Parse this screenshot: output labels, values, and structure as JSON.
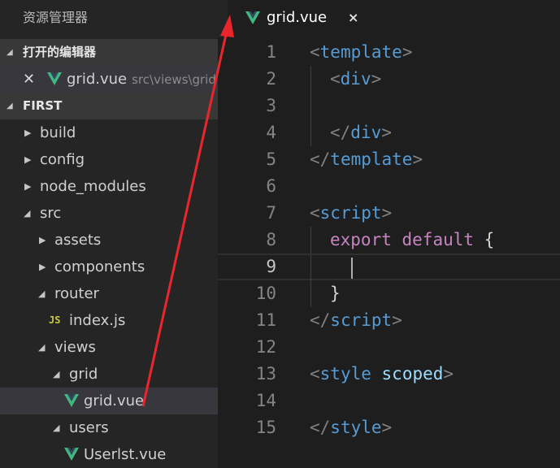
{
  "explorer": {
    "title": "资源管理器",
    "open_editors": {
      "header": "打开的编辑器",
      "items": [
        {
          "name": "grid.vue",
          "path": "src\\views\\grid"
        }
      ]
    },
    "project": {
      "header": "FIRST",
      "tree": [
        {
          "label": "build"
        },
        {
          "label": "config"
        },
        {
          "label": "node_modules"
        },
        {
          "label": "src"
        },
        {
          "label": "assets"
        },
        {
          "label": "components"
        },
        {
          "label": "router"
        },
        {
          "label": "index.js",
          "icon": "JS"
        },
        {
          "label": "views"
        },
        {
          "label": "grid"
        },
        {
          "label": "grid.vue"
        },
        {
          "label": "users"
        },
        {
          "label": "Userlst.vue"
        }
      ]
    }
  },
  "tab": {
    "label": "grid.vue",
    "close_glyph": "×"
  },
  "editor": {
    "current_line": 9,
    "lines": [
      {
        "n": "1",
        "tokens": [
          [
            "punc",
            "<"
          ],
          [
            "tag",
            "template"
          ],
          [
            "punc",
            ">"
          ]
        ]
      },
      {
        "n": "2",
        "tokens": [
          [
            "punc",
            "<"
          ],
          [
            "tag",
            "div"
          ],
          [
            "punc",
            ">"
          ]
        ]
      },
      {
        "n": "3",
        "tokens": []
      },
      {
        "n": "4",
        "tokens": [
          [
            "punc",
            "</"
          ],
          [
            "tag",
            "div"
          ],
          [
            "punc",
            ">"
          ]
        ]
      },
      {
        "n": "5",
        "tokens": [
          [
            "punc",
            "</"
          ],
          [
            "tag",
            "template"
          ],
          [
            "punc",
            ">"
          ]
        ]
      },
      {
        "n": "6",
        "tokens": []
      },
      {
        "n": "7",
        "tokens": [
          [
            "punc",
            "<"
          ],
          [
            "tag",
            "script"
          ],
          [
            "punc",
            ">"
          ]
        ]
      },
      {
        "n": "8",
        "tokens": [
          [
            "kw",
            "export"
          ],
          [
            "plain",
            " "
          ],
          [
            "kw",
            "default"
          ],
          [
            "plain",
            " {"
          ]
        ]
      },
      {
        "n": "9",
        "tokens": []
      },
      {
        "n": "10",
        "tokens": [
          [
            "plain",
            "}"
          ]
        ]
      },
      {
        "n": "11",
        "tokens": [
          [
            "punc",
            "</"
          ],
          [
            "tag",
            "script"
          ],
          [
            "punc",
            ">"
          ]
        ]
      },
      {
        "n": "12",
        "tokens": []
      },
      {
        "n": "13",
        "tokens": [
          [
            "punc",
            "<"
          ],
          [
            "tag",
            "style"
          ],
          [
            "plain",
            " "
          ],
          [
            "attr",
            "scoped"
          ],
          [
            "punc",
            ">"
          ]
        ]
      },
      {
        "n": "14",
        "tokens": []
      },
      {
        "n": "15",
        "tokens": [
          [
            "punc",
            "</"
          ],
          [
            "tag",
            "style"
          ],
          [
            "punc",
            ">"
          ]
        ]
      }
    ]
  },
  "colors": {
    "vue_green": "#41b883",
    "annotation_arrow": "#e8262c"
  },
  "icons": {
    "vue": "vue-logo-icon",
    "js": "javascript-file-icon",
    "caret_open": "caret-down-icon",
    "caret_closed": "caret-right-icon",
    "close": "close-icon"
  }
}
